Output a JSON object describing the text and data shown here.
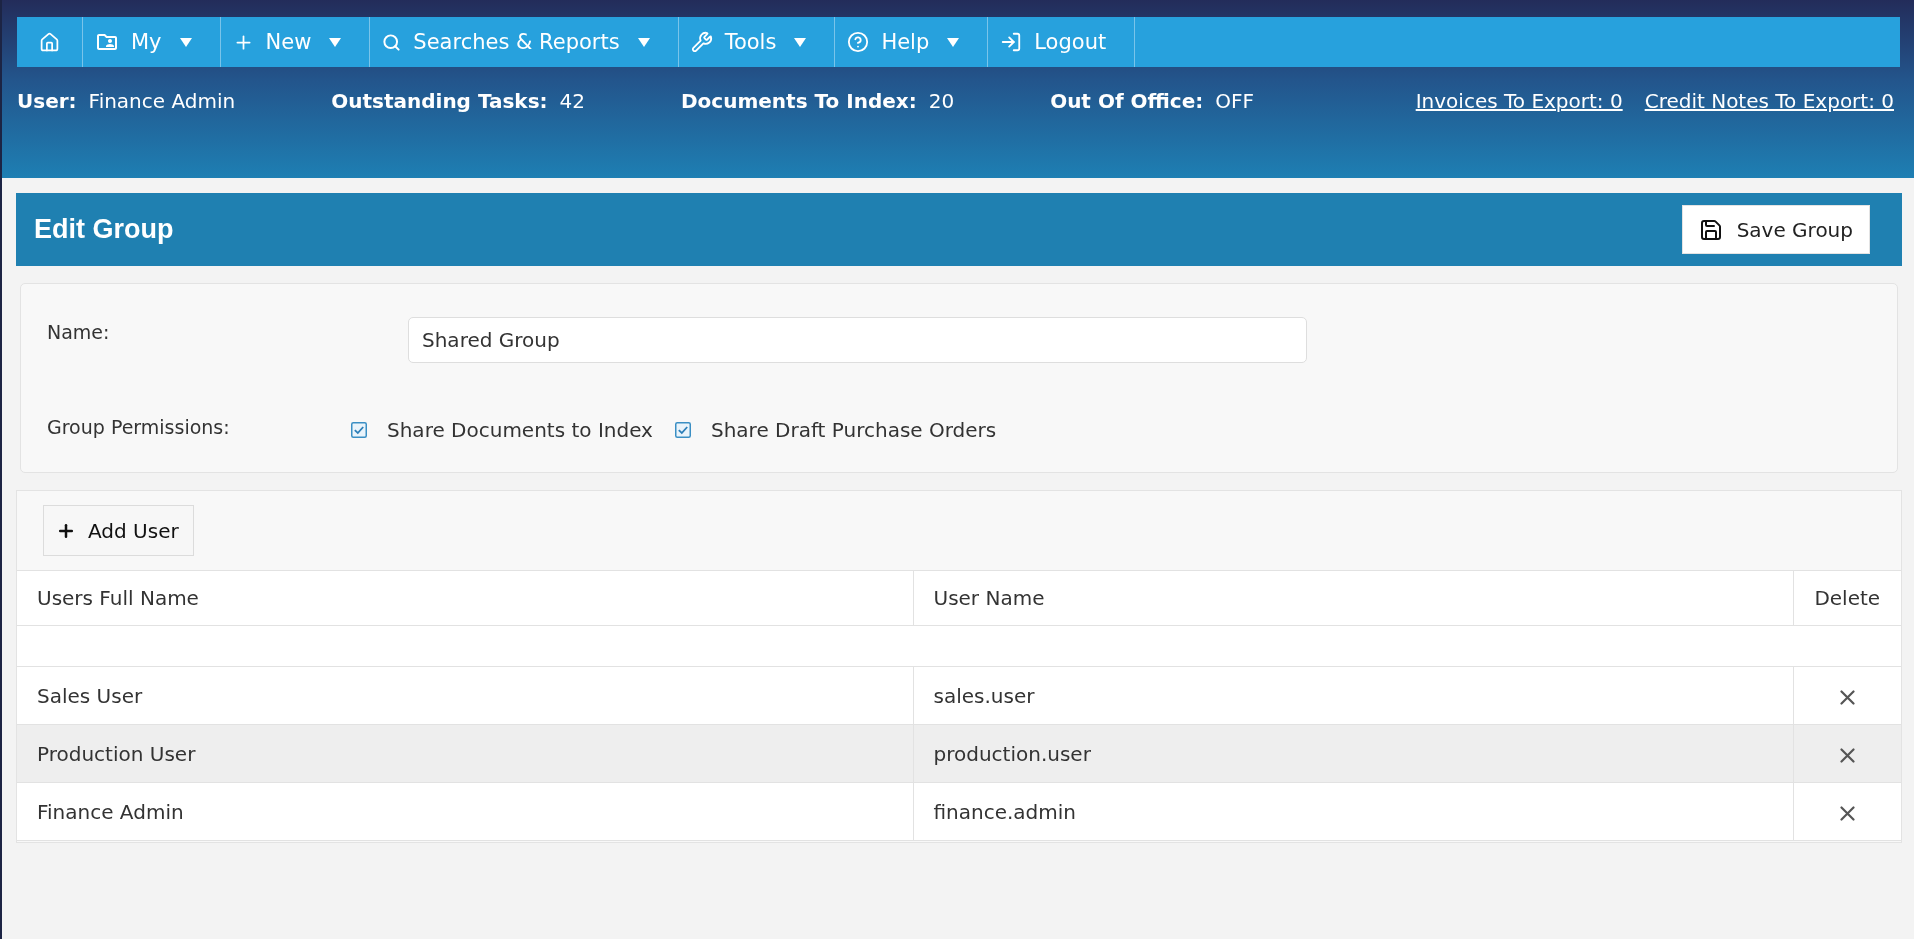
{
  "nav": {
    "items": [
      {
        "dropdown": false
      },
      {
        "label": "My",
        "dropdown": true
      },
      {
        "label": "New",
        "dropdown": true
      },
      {
        "label": "Searches & Reports",
        "dropdown": true
      },
      {
        "label": "Tools",
        "dropdown": true
      },
      {
        "label": "Help",
        "dropdown": true
      },
      {
        "label": "Logout",
        "dropdown": false
      }
    ]
  },
  "status": {
    "fields": [
      {
        "label": "User:",
        "value": "Finance Admin"
      },
      {
        "label": "Outstanding Tasks:",
        "value": "42"
      },
      {
        "label": "Documents To Index:",
        "value": "20"
      },
      {
        "label": "Out Of Office:",
        "value": "OFF"
      }
    ],
    "links": [
      "Invoices To Export: 0",
      "Credit Notes To Export: 0"
    ]
  },
  "page": {
    "title": "Edit Group",
    "save_button": "Save Group"
  },
  "form": {
    "name_label": "Name:",
    "name_value": "Shared Group",
    "permissions_label": "Group Permissions:",
    "permissions": [
      {
        "label": "Share Documents to Index",
        "checked": true
      },
      {
        "label": "Share Draft Purchase Orders",
        "checked": true
      }
    ]
  },
  "users": {
    "add_button": "Add User",
    "columns": [
      "Users Full Name",
      "User Name",
      "Delete"
    ],
    "rows": [
      {
        "full_name": "Sales User",
        "user_name": "sales.user",
        "highlighted": false
      },
      {
        "full_name": "Production User",
        "user_name": "production.user",
        "highlighted": true
      },
      {
        "full_name": "Finance Admin",
        "user_name": "finance.admin",
        "highlighted": false
      }
    ]
  }
}
